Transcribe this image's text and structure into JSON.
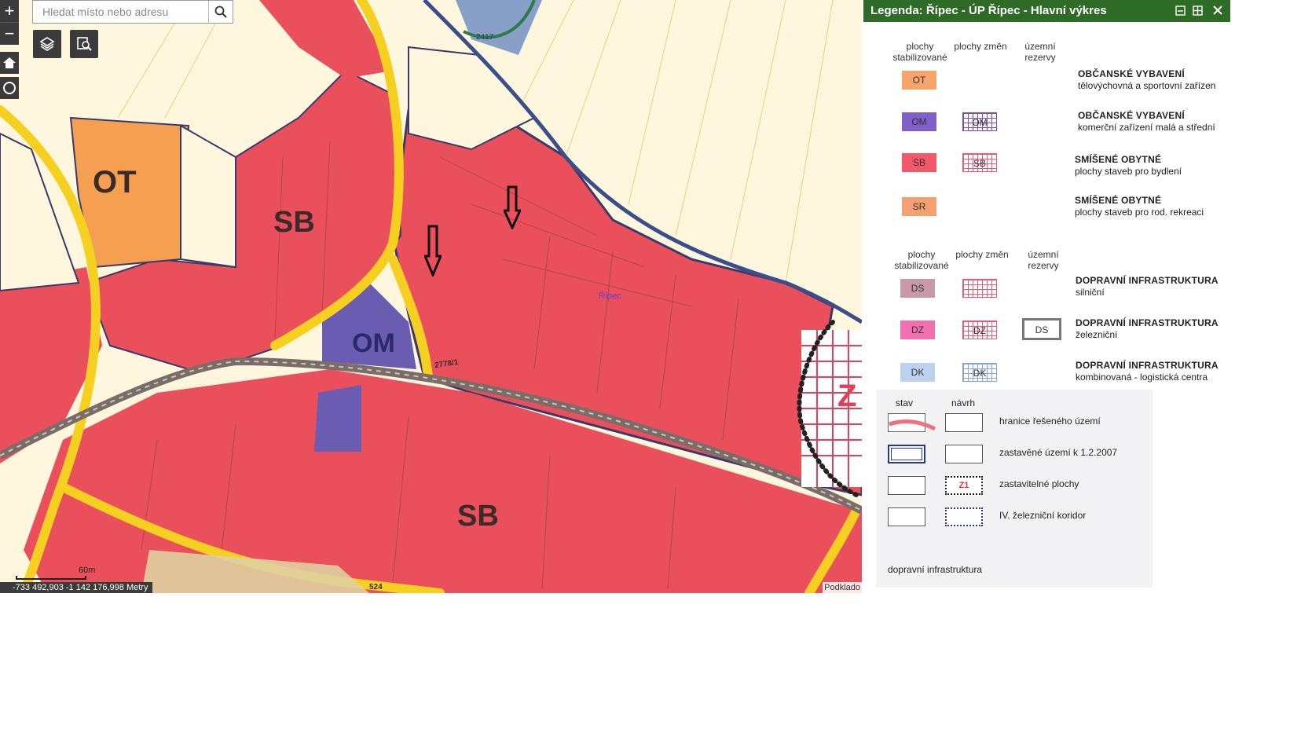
{
  "map": {
    "search_placeholder": "Hledat místo nebo adresu",
    "coordinates": "-733 492,903 -1 142 176,998 Metry",
    "scale_label": "60m",
    "attribution": "Podklado",
    "labels": {
      "ot": "OT",
      "sb1": "SB",
      "sb2": "SB",
      "om": "OM",
      "ripec": "Řípec",
      "z": "Z",
      "parcel_524": "524",
      "parcel_2778_1": "2778/1",
      "parcel_2417": "2417"
    },
    "colors": {
      "residential": "#e8525e",
      "civic_sport": "#f0a05a",
      "commercial": "#6c5cb5",
      "road": "#f5d322",
      "rail": "#7a6f6a",
      "background": "#fff5dc"
    }
  },
  "controls": {
    "zoom_in": "+",
    "zoom_out": "−"
  },
  "legend_panel": {
    "title": "Legenda: Řípec - ÚP Řípec - Hlavní výkres",
    "section1": {
      "col1": "plochy stabilizované",
      "col2": "plochy změn",
      "col3": "územní rezervy",
      "rows": [
        {
          "code": "OT",
          "code_change": "",
          "title": "OBČANSKÉ VYBAVENÍ",
          "sub": "tělovýchovná a sportovní zařízen",
          "color": "#f7a56a"
        },
        {
          "code": "OM",
          "code_change": "OM",
          "title": "OBČANSKÉ VYBAVENÍ",
          "sub": "komerční zařízení malá a střední",
          "color": "#8060c8"
        },
        {
          "code": "SB",
          "code_change": "SB",
          "title": "SMÍŠENÉ OBYTNÉ",
          "sub": "plochy staveb pro bydlení",
          "color": "#f2586a"
        },
        {
          "code": "SR",
          "code_change": "",
          "title": "SMÍŠENÉ OBYTNÉ",
          "sub": "plochy staveb pro rod. rekreaci",
          "color": "#f5a070"
        }
      ]
    },
    "section2": {
      "col1": "plochy stabilizované",
      "col2": "plochy změn",
      "col3": "územní rezervy",
      "rows": [
        {
          "code": "DS",
          "code_change": "",
          "code_reserve": "",
          "title": "DOPRAVNÍ INFRASTRUKTURA",
          "sub": "silniční",
          "color": "#c89aa8"
        },
        {
          "code": "DZ",
          "code_change": "DZ",
          "code_reserve": "DS",
          "title": "DOPRAVNÍ INFRASTRUKTURA",
          "sub": "železniční",
          "color": "#f070b0"
        },
        {
          "code": "DK",
          "code_change": "DK",
          "code_reserve": "",
          "title": "DOPRAVNÍ INFRASTRUKTURA",
          "sub": "kombinovaná - logistická centra",
          "color": "#bcd0f0"
        }
      ]
    },
    "section3": {
      "col_stav": "stav",
      "col_navrh": "návrh",
      "rows": [
        {
          "label": "hranice řešeného území"
        },
        {
          "label": "zastavěné území k 1.2.2007"
        },
        {
          "label": "zastavitelné plochy",
          "badge": "Z1"
        },
        {
          "label": "IV. železniční koridor"
        }
      ],
      "footer": "dopravní infrastruktura"
    }
  }
}
